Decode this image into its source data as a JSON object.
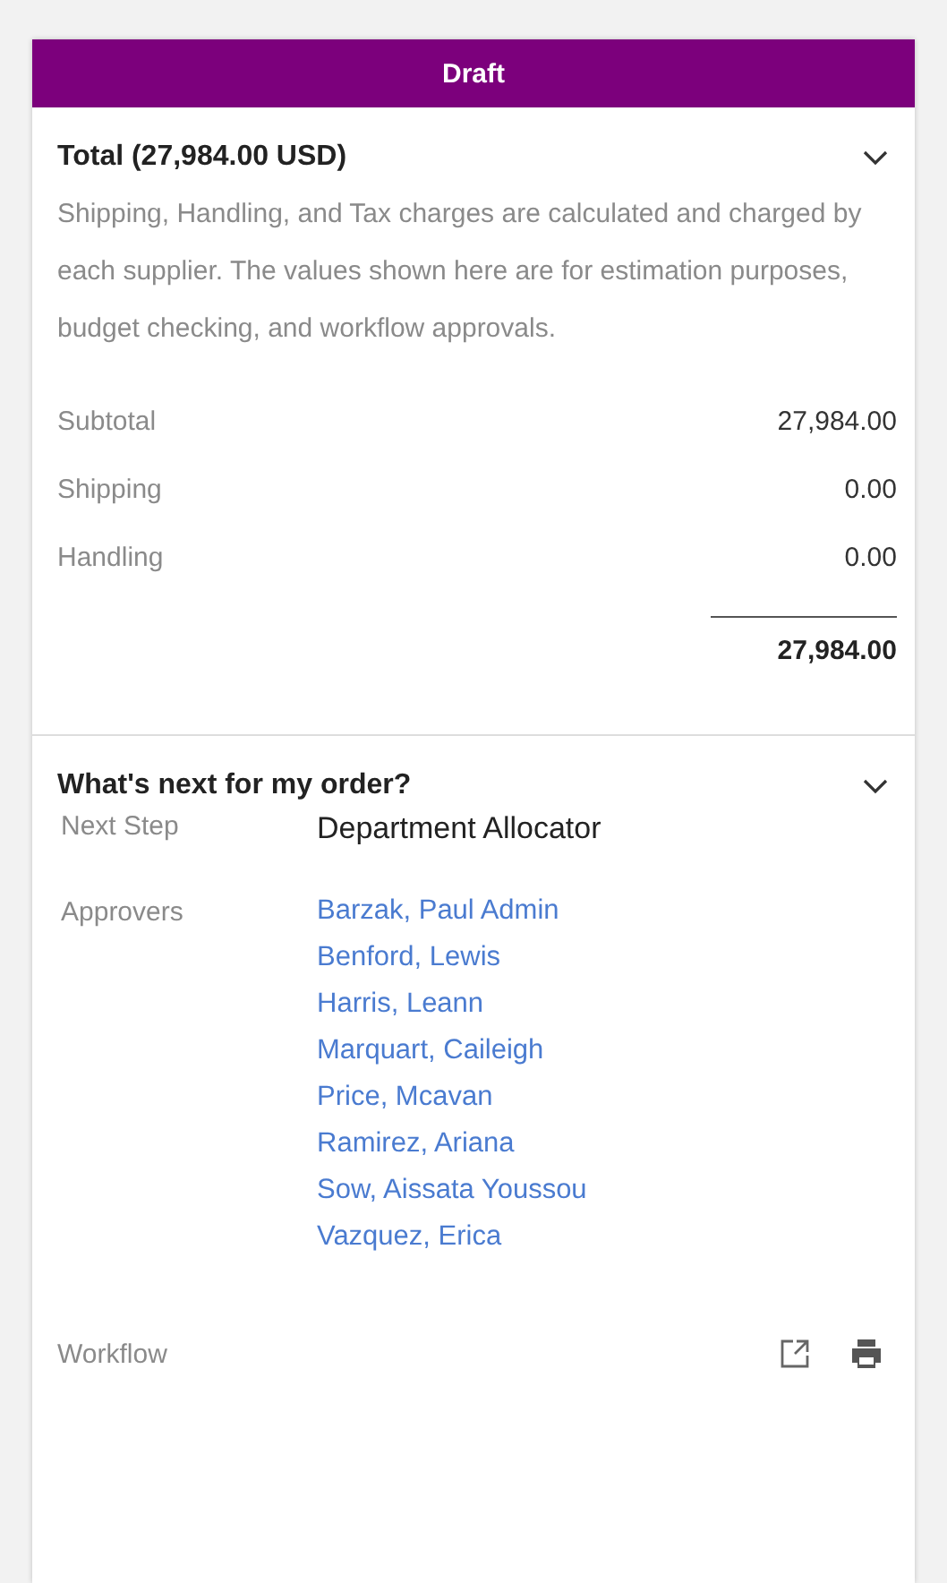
{
  "status_banner": {
    "label": "Draft"
  },
  "total_section": {
    "title": "Total (27,984.00 USD)",
    "expanded": true,
    "note": "Shipping, Handling, and Tax charges are calculated and charged by each supplier. The values shown here are for estimation purposes, budget checking, and workflow approvals.",
    "lines": [
      {
        "label": "Subtotal",
        "value": "27,984.00"
      },
      {
        "label": "Shipping",
        "value": "0.00"
      },
      {
        "label": "Handling",
        "value": "0.00"
      }
    ],
    "total": "27,984.00"
  },
  "next_section": {
    "title": "What's next for my order?",
    "expanded": true,
    "next_step_label": "Next Step",
    "next_step": "Department Allocator",
    "approvers_label": "Approvers",
    "approvers": [
      "Barzak, Paul Admin",
      "Benford, Lewis",
      "Harris, Leann",
      "Marquart, Caileigh",
      "Price, Mcavan",
      "Ramirez, Ariana",
      "Sow, Aissata Youssou",
      "Vazquez, Erica"
    ],
    "workflow_label": "Workflow"
  }
}
